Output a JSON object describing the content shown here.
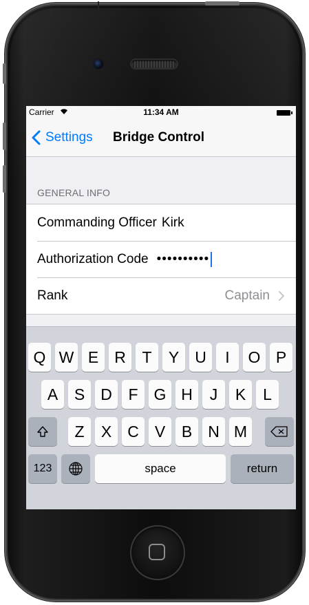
{
  "status_bar": {
    "carrier": "Carrier",
    "wifi_icon": "wifi-icon",
    "time": "11:34 AM",
    "battery_icon": "battery-icon"
  },
  "nav": {
    "back_label": "Settings",
    "title": "Bridge Control"
  },
  "section_header": "GENERAL INFO",
  "rows": [
    {
      "label": "Commanding Officer",
      "value": "Kirk"
    },
    {
      "label": "Authorization Code",
      "value": "••••••••••"
    },
    {
      "label": "Rank",
      "value": "Captain"
    }
  ],
  "keyboard": {
    "row1": [
      "Q",
      "W",
      "E",
      "R",
      "T",
      "Y",
      "U",
      "I",
      "O",
      "P"
    ],
    "row2": [
      "A",
      "S",
      "D",
      "F",
      "G",
      "H",
      "J",
      "K",
      "L"
    ],
    "row3": [
      "Z",
      "X",
      "C",
      "V",
      "B",
      "N",
      "M"
    ],
    "numbers_label": "123",
    "space_label": "space",
    "return_label": "return"
  },
  "colors": {
    "tint": "#007aff",
    "keyboard_bg": "#d1d5db",
    "cursor": "#1e73e6"
  }
}
